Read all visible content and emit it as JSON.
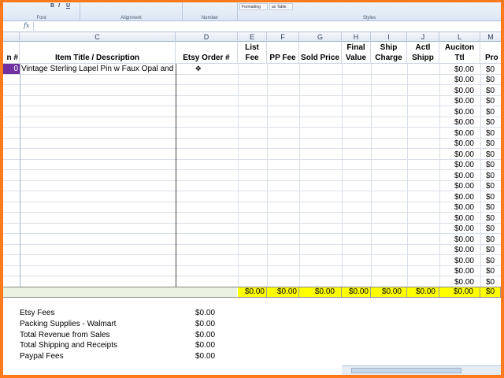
{
  "ribbon": {
    "groups": [
      "Font",
      "Alignment",
      "Number",
      "Styles"
    ],
    "chips": [
      "Formatting",
      "as Table"
    ]
  },
  "formula_bar": {
    "fx": "fx"
  },
  "columns": [
    "C",
    "D",
    "E",
    "F",
    "G",
    "H",
    "I",
    "J",
    "L",
    "M"
  ],
  "headers": {
    "item_no": "n #",
    "title": "Item Title / Description",
    "etsy_order": "Etsy Order #",
    "list_fee": "List Fee",
    "pp_fee": "PP Fee",
    "sold_price": "Sold Price",
    "final_value": "Final Value",
    "ship_charge": "Ship Charge",
    "actl_shipp": "Actl Shipp",
    "auction_ttl": "Auciton Ttl",
    "profit": "Pro"
  },
  "first_row": {
    "item_no": "0",
    "title": "Vintage Sterling Lapel Pin w Faux Opal and"
  },
  "auction_total_value": "$0.00",
  "profit_value": "$0",
  "totals": [
    "$0.00",
    "$0.00",
    "$0.00",
    "$0.00",
    "$0.00",
    "$0.00",
    "$0.00",
    "$0"
  ],
  "summary": [
    {
      "label": "Etsy Fees",
      "value": "$0.00"
    },
    {
      "label": "Packing Supplies - Walmart",
      "value": "$0.00"
    },
    {
      "label": "Total Revenue from Sales",
      "value": "$0.00"
    },
    {
      "label": "Total Shipping and Receipts",
      "value": "$0.00"
    },
    {
      "label": "Paypal Fees",
      "value": "$0.00"
    }
  ]
}
